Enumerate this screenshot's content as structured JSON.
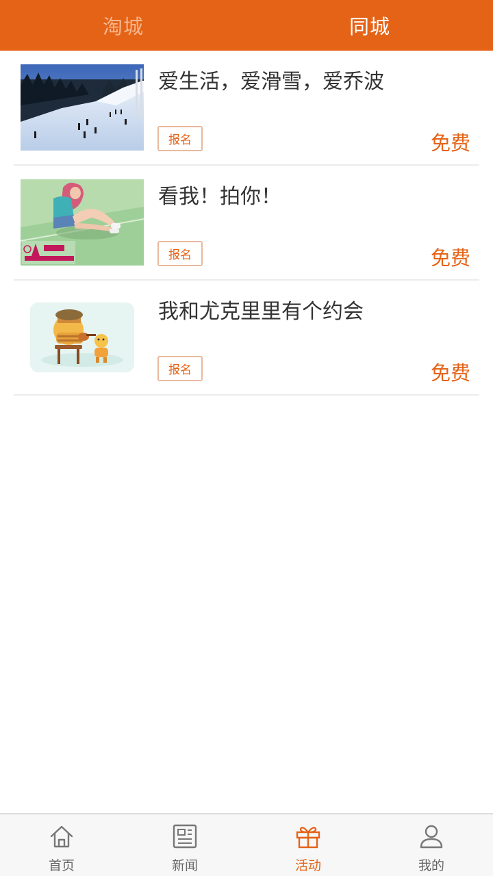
{
  "top_tabs": {
    "taocheng": "淘城",
    "tongcheng": "同城"
  },
  "events": [
    {
      "title": "爱生活，爱滑雪，爱乔波",
      "signup_label": "报名",
      "price": "免费",
      "image": "ski-slope-photo"
    },
    {
      "title": "看我！拍你！",
      "signup_label": "报名",
      "price": "免费",
      "image": "girl-sitting-on-grass-photo",
      "image_watermark": "卡罗拉 私人摄影会所"
    },
    {
      "title": "我和尤克里里有个约会",
      "signup_label": "报名",
      "price": "免费",
      "image": "cartoon-ukulele-illustration"
    }
  ],
  "bottom_nav": {
    "home": "首页",
    "news": "新闻",
    "activities": "活动",
    "mine": "我的",
    "active_tab": "activities"
  },
  "colors": {
    "accent": "#e46317",
    "accent_light": "#f6b78f",
    "text": "#333333",
    "divider": "#ececec"
  }
}
